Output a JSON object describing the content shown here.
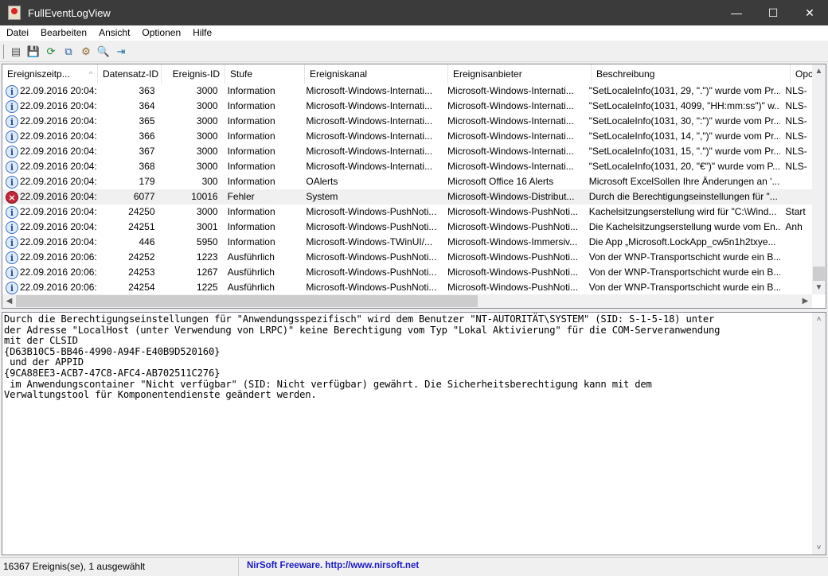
{
  "window": {
    "title": "FullEventLogView"
  },
  "menu": [
    "Datei",
    "Bearbeiten",
    "Ansicht",
    "Optionen",
    "Hilfe"
  ],
  "toolbar": [
    {
      "icon": "properties-icon",
      "symbol": "▤"
    },
    {
      "icon": "save-icon",
      "symbol": "💾"
    },
    {
      "icon": "refresh-icon",
      "symbol": "⟳"
    },
    {
      "icon": "copy-icon",
      "symbol": "⧉"
    },
    {
      "icon": "options-icon",
      "symbol": "⚙"
    },
    {
      "icon": "find-icon",
      "symbol": "🔍"
    },
    {
      "icon": "exit-icon",
      "symbol": "⇥"
    }
  ],
  "columns": [
    "Ereigniszeitp...",
    "Datensatz-ID",
    "Ereignis-ID",
    "Stufe",
    "Ereigniskanal",
    "Ereignisanbieter",
    "Beschreibung",
    "Opc"
  ],
  "sort_indicator": "^",
  "rows": [
    {
      "icon": "info",
      "time": "22.09.2016 20:04:...",
      "record": "363",
      "event": "3000",
      "level": "Information",
      "channel": "Microsoft-Windows-Internati...",
      "provider": "Microsoft-Windows-Internati...",
      "desc": "\"SetLocaleInfo(1031, 29, \".\")\" wurde vom Pr...",
      "opc": "NLS-"
    },
    {
      "icon": "info",
      "time": "22.09.2016 20:04:...",
      "record": "364",
      "event": "3000",
      "level": "Information",
      "channel": "Microsoft-Windows-Internati...",
      "provider": "Microsoft-Windows-Internati...",
      "desc": "\"SetLocaleInfo(1031, 4099, \"HH:mm:ss\")\" w...",
      "opc": "NLS-"
    },
    {
      "icon": "info",
      "time": "22.09.2016 20:04:...",
      "record": "365",
      "event": "3000",
      "level": "Information",
      "channel": "Microsoft-Windows-Internati...",
      "provider": "Microsoft-Windows-Internati...",
      "desc": "\"SetLocaleInfo(1031, 30, \":\")\" wurde vom Pr...",
      "opc": "NLS-"
    },
    {
      "icon": "info",
      "time": "22.09.2016 20:04:...",
      "record": "366",
      "event": "3000",
      "level": "Information",
      "channel": "Microsoft-Windows-Internati...",
      "provider": "Microsoft-Windows-Internati...",
      "desc": "\"SetLocaleInfo(1031, 14, \",\")\" wurde vom Pr...",
      "opc": "NLS-"
    },
    {
      "icon": "info",
      "time": "22.09.2016 20:04:...",
      "record": "367",
      "event": "3000",
      "level": "Information",
      "channel": "Microsoft-Windows-Internati...",
      "provider": "Microsoft-Windows-Internati...",
      "desc": "\"SetLocaleInfo(1031, 15, \".\")\" wurde vom Pr...",
      "opc": "NLS-"
    },
    {
      "icon": "info",
      "time": "22.09.2016 20:04:...",
      "record": "368",
      "event": "3000",
      "level": "Information",
      "channel": "Microsoft-Windows-Internati...",
      "provider": "Microsoft-Windows-Internati...",
      "desc": "\"SetLocaleInfo(1031, 20, \"€\")\" wurde vom P...",
      "opc": "NLS-"
    },
    {
      "icon": "info",
      "time": "22.09.2016 20:04:...",
      "record": "179",
      "event": "300",
      "level": "Information",
      "channel": "OAlerts",
      "provider": "Microsoft Office 16 Alerts",
      "desc": "Microsoft ExcelSollen Ihre Änderungen an '...",
      "opc": ""
    },
    {
      "icon": "error",
      "selected": true,
      "time": "22.09.2016 20:04:...",
      "record": "6077",
      "event": "10016",
      "level": "Fehler",
      "channel": "System",
      "provider": "Microsoft-Windows-Distribut...",
      "desc": "Durch die Berechtigungseinstellungen für \"...",
      "opc": ""
    },
    {
      "icon": "info",
      "time": "22.09.2016 20:04:...",
      "record": "24250",
      "event": "3000",
      "level": "Information",
      "channel": "Microsoft-Windows-PushNoti...",
      "provider": "Microsoft-Windows-PushNoti...",
      "desc": "Kachelsitzungserstellung wird für \"C:\\Wind...",
      "opc": "Start"
    },
    {
      "icon": "info",
      "time": "22.09.2016 20:04:...",
      "record": "24251",
      "event": "3001",
      "level": "Information",
      "channel": "Microsoft-Windows-PushNoti...",
      "provider": "Microsoft-Windows-PushNoti...",
      "desc": "Die Kachelsitzungserstellung wurde vom En...",
      "opc": "Anh"
    },
    {
      "icon": "info",
      "time": "22.09.2016 20:04:...",
      "record": "446",
      "event": "5950",
      "level": "Information",
      "channel": "Microsoft-Windows-TWinUI/...",
      "provider": "Microsoft-Windows-Immersiv...",
      "desc": "Die App „Microsoft.LockApp_cw5n1h2txye...",
      "opc": ""
    },
    {
      "icon": "info",
      "time": "22.09.2016 20:06:...",
      "record": "24252",
      "event": "1223",
      "level": "Ausführlich",
      "channel": "Microsoft-Windows-PushNoti...",
      "provider": "Microsoft-Windows-PushNoti...",
      "desc": "Von der WNP-Transportschicht wurde ein B...",
      "opc": ""
    },
    {
      "icon": "info",
      "time": "22.09.2016 20:06:...",
      "record": "24253",
      "event": "1267",
      "level": "Ausführlich",
      "channel": "Microsoft-Windows-PushNoti...",
      "provider": "Microsoft-Windows-PushNoti...",
      "desc": "Von der WNP-Transportschicht wurde ein B...",
      "opc": ""
    },
    {
      "icon": "info",
      "time": "22.09.2016 20:06:...",
      "record": "24254",
      "event": "1225",
      "level": "Ausführlich",
      "channel": "Microsoft-Windows-PushNoti...",
      "provider": "Microsoft-Windows-PushNoti...",
      "desc": "Von der WNP-Transportschicht wurde ein B...",
      "opc": ""
    }
  ],
  "detail_text": "Durch die Berechtigungseinstellungen für \"Anwendungsspezifisch\" wird dem Benutzer \"NT-AUTORITÄT\\SYSTEM\" (SID: S-1-5-18) unter\nder Adresse \"LocalHost (unter Verwendung von LRPC)\" keine Berechtigung vom Typ \"Lokal Aktivierung\" für die COM-Serveranwendung\nmit der CLSID\n{D63B10C5-BB46-4990-A94F-E40B9D520160}\n und der APPID\n{9CA88EE3-ACB7-47C8-AFC4-AB702511C276}\n im Anwendungscontainer \"Nicht verfügbar\" (SID: Nicht verfügbar) gewährt. Die Sicherheitsberechtigung kann mit dem\nVerwaltungstool für Komponentendienste geändert werden.",
  "status": {
    "count": "16367 Ereignis(se), 1 ausgewählt",
    "credit": "NirSoft Freeware.  http://www.nirsoft.net"
  },
  "colors": {
    "titlebar": "#3b3b3b",
    "link": "#1a1acc",
    "error": "#c0283a",
    "info": "#3a6fc0"
  }
}
